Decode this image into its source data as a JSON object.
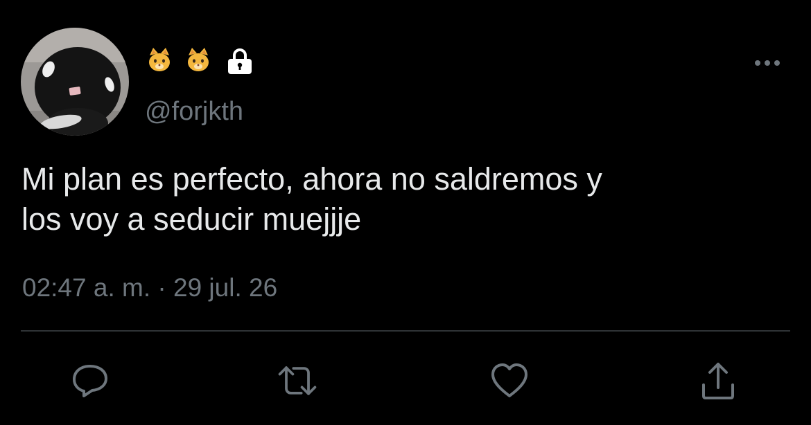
{
  "colors": {
    "background": "#000000",
    "text_primary": "#e7e9ea",
    "text_secondary": "#6e767d",
    "divider": "#2f3336",
    "lock_icon": "#ffffff"
  },
  "author": {
    "avatar_icon": "plush-toy-avatar",
    "display_name_icons": [
      "cat-face-emoji",
      "cat-face-emoji",
      "lock-icon"
    ],
    "handle": "@forjkth"
  },
  "tweet": {
    "text": "Mi plan es perfecto, ahora no saldremos y\nlos voy a seducir muejjje",
    "timestamp": "02:47 a. m. · 29 jul. 26"
  },
  "actions": {
    "more_icon": "more-dots-icon",
    "items": [
      "reply-icon",
      "retweet-icon",
      "like-icon",
      "share-icon"
    ]
  }
}
